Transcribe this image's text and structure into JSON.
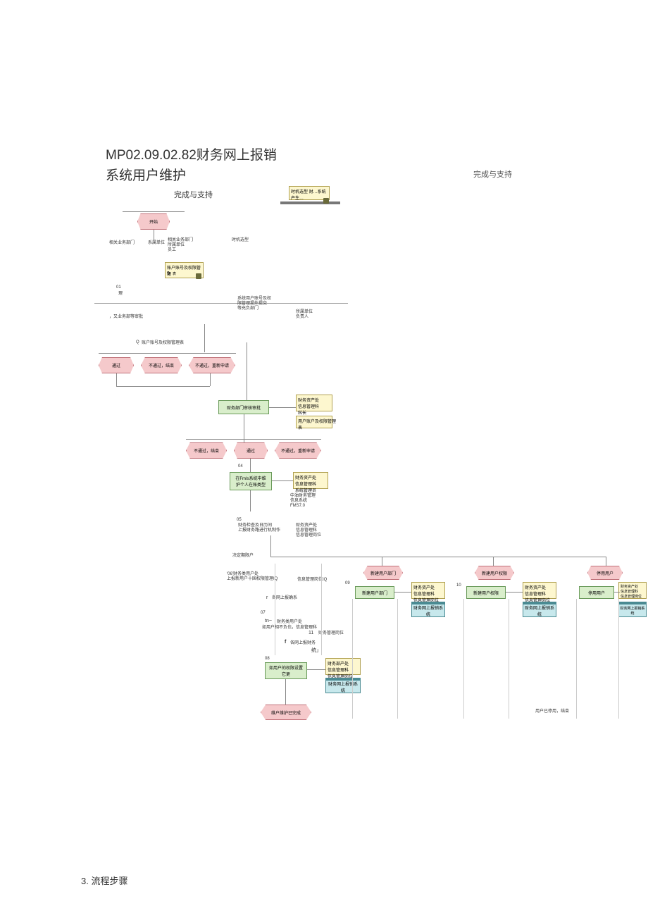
{
  "title": {
    "line1": "MP02.09.02.82财务网上报销",
    "line2": "系统用户维护"
  },
  "header": {
    "right": "完成与支持",
    "mid": "完成与支持"
  },
  "diagram": {
    "note_top": "时机选型 财…系统产生…",
    "start": "开始",
    "t_dept_fin": "相关业务部门",
    "t_sys_unit": "系属单位",
    "t_dept_fin2": "相关业务部门\n所属单位\n员工",
    "t_timing": "时机选型",
    "note_acct_perm": "账户账号及权限管理",
    "num9": "9",
    "dot_suffix": "表",
    "step01": "01",
    "step01b": "理",
    "t_review_sys": "系统用户账号及权\n限管理提外提交\n等充负部门",
    "t_unit_resp": "所属单位\n负责人",
    "t_bullet_left": "，又业务部等审批",
    "q_label": "Q",
    "q_text": "账户账号及权限管理表",
    "hex_pass": "通过",
    "hex_reject": "不通过，结束",
    "hex_retry": "不通过，重新申请",
    "green_fin_review": "财务部门审核审批",
    "note_fin_mgr": "财务资产处\n信息管理科\n科长",
    "note_perm_table": "用户账户及权限管理\n表",
    "hex_reject2": "不通过，结束",
    "hex_pass2": "通过",
    "hex_retry2": "不通过，重新申请",
    "step04": "04",
    "green_fmis": "在FmIs系统中维\n护个人在账类型",
    "note_fmis_role": "财务资产处\n信息管理科\n系统管理员",
    "t_fmis_sys": "中油财务管理\n信息系统\nFMS7.0",
    "step05": "05",
    "t_decide": "财务检查及日历间\n上报财务路进行机制作",
    "t_decide_role": "财务资产处\n信息管理科\n信息管理岗位",
    "t_decide_type": "决定期限户",
    "t_fin_user": "'06'财务类用户处\n上报新用户十国权限管理IQ",
    "t_mgmt_pos": "信息管理岗位IQ",
    "r_label": "r",
    "r_text": "各网上报确系",
    "step07": "07",
    "tn_label": "tn~",
    "tn_text": "财务类用户处",
    "tn_text2": "如用户相不负也，信息管理科",
    "num11": "11",
    "t_fin_mgmt_pos": "财务管理岗位",
    "f_label": "f",
    "f_text": "各网上报财务",
    "t_sys_end": "统」",
    "step08": "08",
    "green_perm_mod": "如用户的权限设置\n它更",
    "note_perm_role": "财务部产处\n信息管理科\n信息管理岗位",
    "cyan_sys1": "财务网上报销系\n统",
    "hex_end": "维户维护已完成",
    "branch1_hex": "新建用户部门",
    "branch1_green": "新建用户部门",
    "branch1_note": "财务资产处\n信息管理科\n信息管理岗位",
    "branch1_cyan": "财务网上报销系\n统",
    "step09": "09",
    "branch2_hex": "新建用户权限",
    "step10": "10",
    "branch2_green": "新建用户权限",
    "branch2_note": "财务资产处\n信息管理科\n信息管理岗位",
    "branch2_cyan": "财务网上报销系\n统",
    "branch3_hex": "停用用户",
    "branch3_green": "停用用户",
    "branch3_note": "财务资产处\n信息管理科\n信息管理岗位",
    "branch3_cyan": "财务网上报销系\n统",
    "t_end_note": "用户已停用，结束"
  },
  "section3": "3. 流程步骤"
}
